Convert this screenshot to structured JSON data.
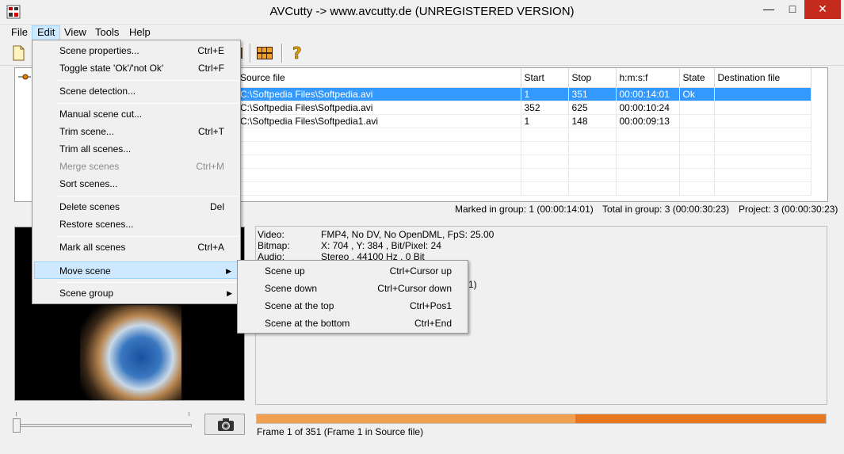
{
  "window": {
    "title": "AVCutty -> www.avcutty.de (UNREGISTERED VERSION)"
  },
  "menubar": {
    "items": [
      "File",
      "Edit",
      "View",
      "Tools",
      "Help"
    ]
  },
  "table": {
    "columns": [
      "Source file",
      "Start",
      "Stop",
      "h:m:s:f",
      "State",
      "Destination file"
    ],
    "rows": [
      [
        "C:\\Softpedia Files\\Softpedia.avi",
        "1",
        "351",
        "00:00:14:01",
        "Ok",
        ""
      ],
      [
        "C:\\Softpedia Files\\Softpedia.avi",
        "352",
        "625",
        "00:00:10:24",
        "",
        ""
      ],
      [
        "C:\\Softpedia Files\\Softpedia1.avi",
        "1",
        "148",
        "00:00:09:13",
        "",
        ""
      ]
    ]
  },
  "status": {
    "marked": "Marked in group: 1 (00:00:14:01)",
    "total": "Total in group: 3 (00:00:30:23)",
    "project": "Project: 3 (00:00:30:23)"
  },
  "info": {
    "video_key": "Video:",
    "video_val": "FMP4, No DV, No OpenDML, FpS: 25.00",
    "bitmap_key": "Bitmap:",
    "bitmap_val": "X: 704 , Y: 384 , Bit/Pixel: 24",
    "audio_key": "Audio:",
    "audio_val": "Stereo , 44100 Hz , 0 Bit",
    "partial": "1)"
  },
  "frame_status": "Frame 1 of 351 (Frame 1 in Source file)",
  "progress": {
    "fill_fraction": 0.56
  },
  "edit_menu": [
    {
      "label": "Scene properties...",
      "shortcut": "Ctrl+E"
    },
    {
      "label": "Toggle state 'Ok'/'not Ok'",
      "shortcut": "Ctrl+F"
    },
    {
      "label": "Scene detection...",
      "shortcut": ""
    },
    {
      "label": "Manual scene cut...",
      "shortcut": ""
    },
    {
      "label": "Trim scene...",
      "shortcut": "Ctrl+T"
    },
    {
      "label": "Trim all scenes...",
      "shortcut": ""
    },
    {
      "label": "Merge scenes",
      "shortcut": "Ctrl+M"
    },
    {
      "label": "Sort scenes...",
      "shortcut": ""
    },
    {
      "label": "Delete scenes",
      "shortcut": "Del"
    },
    {
      "label": "Restore scenes...",
      "shortcut": ""
    },
    {
      "label": "Mark all scenes",
      "shortcut": "Ctrl+A"
    },
    {
      "label": "Move scene",
      "shortcut": ""
    },
    {
      "label": "Scene group",
      "shortcut": ""
    }
  ],
  "move_submenu": [
    {
      "label": "Scene up",
      "shortcut": "Ctrl+Cursor up"
    },
    {
      "label": "Scene down",
      "shortcut": "Ctrl+Cursor down"
    },
    {
      "label": "Scene at the top",
      "shortcut": "Ctrl+Pos1"
    },
    {
      "label": "Scene at the bottom",
      "shortcut": "Ctrl+End"
    }
  ]
}
